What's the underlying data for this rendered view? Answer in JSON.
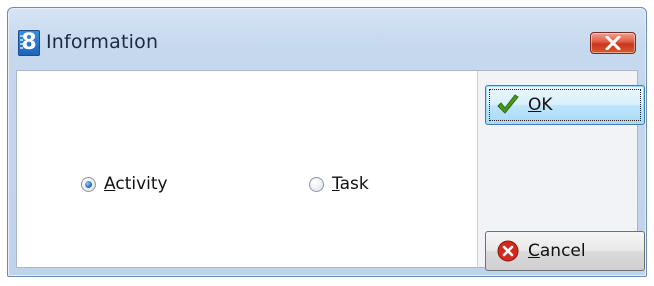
{
  "window": {
    "title": "Information",
    "app_icon_glyph": "8"
  },
  "options": {
    "activity": {
      "mnemonic": "A",
      "rest": "ctivity",
      "selected": true
    },
    "task": {
      "mnemonic": "T",
      "rest": "ask",
      "selected": false
    }
  },
  "buttons": {
    "ok": {
      "mnemonic": "O",
      "rest": "K",
      "icon": "checkmark-icon"
    },
    "cancel": {
      "mnemonic": "C",
      "rest": "ancel",
      "icon": "cancel-x-icon"
    }
  },
  "colors": {
    "title_bar": "#c6d8ee",
    "close_red": "#c8361b",
    "checkmark_green": "#4a9a1e",
    "cancel_red": "#d12a1f"
  }
}
